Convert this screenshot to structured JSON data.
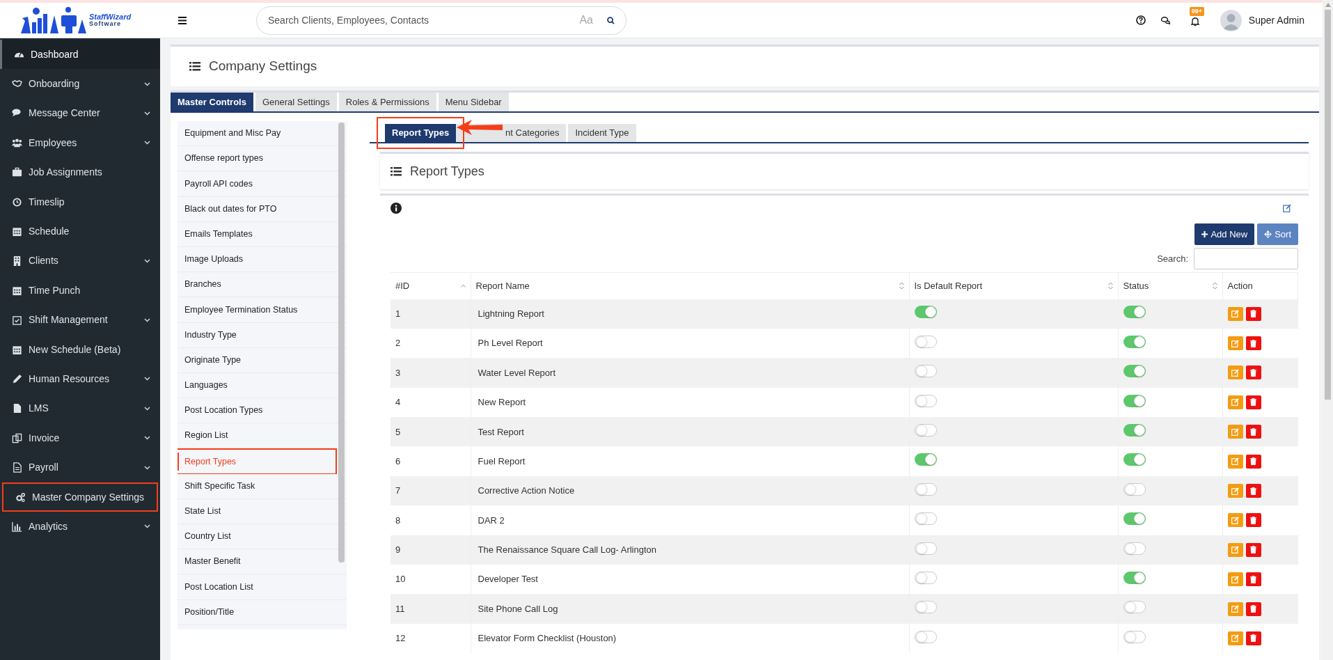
{
  "header": {
    "logo_name": "StaffWizard",
    "logo_tagline": "Software",
    "search_placeholder": "Search Clients, Employees, Contacts",
    "case_toggle": "Aa",
    "notification_count": "99+",
    "user_name": "Super Admin"
  },
  "sidebar": {
    "items": [
      {
        "label": "Dashboard",
        "has_submenu": false,
        "selected": true,
        "annotated": false
      },
      {
        "label": "Onboarding",
        "has_submenu": true,
        "selected": false,
        "annotated": false
      },
      {
        "label": "Message Center",
        "has_submenu": true,
        "selected": false,
        "annotated": false
      },
      {
        "label": "Employees",
        "has_submenu": true,
        "selected": false,
        "annotated": false
      },
      {
        "label": "Job Assignments",
        "has_submenu": false,
        "selected": false,
        "annotated": false
      },
      {
        "label": "Timeslip",
        "has_submenu": false,
        "selected": false,
        "annotated": false
      },
      {
        "label": "Schedule",
        "has_submenu": false,
        "selected": false,
        "annotated": false
      },
      {
        "label": "Clients",
        "has_submenu": true,
        "selected": false,
        "annotated": false
      },
      {
        "label": "Time Punch",
        "has_submenu": false,
        "selected": false,
        "annotated": false
      },
      {
        "label": "Shift Management",
        "has_submenu": true,
        "selected": false,
        "annotated": false
      },
      {
        "label": "New Schedule (Beta)",
        "has_submenu": false,
        "selected": false,
        "annotated": false
      },
      {
        "label": "Human Resources",
        "has_submenu": true,
        "selected": false,
        "annotated": false
      },
      {
        "label": "LMS",
        "has_submenu": true,
        "selected": false,
        "annotated": false
      },
      {
        "label": "Invoice",
        "has_submenu": true,
        "selected": false,
        "annotated": false
      },
      {
        "label": "Payroll",
        "has_submenu": true,
        "selected": false,
        "annotated": false
      },
      {
        "label": "Master Company Settings",
        "has_submenu": false,
        "selected": false,
        "annotated": true
      },
      {
        "label": "Analytics",
        "has_submenu": true,
        "selected": false,
        "annotated": false
      }
    ]
  },
  "page_title": "Company Settings",
  "tabs": [
    {
      "label": "Master Controls",
      "selected": true
    },
    {
      "label": "General Settings",
      "selected": false
    },
    {
      "label": "Roles & Permissions",
      "selected": false
    },
    {
      "label": "Menu Sidebar",
      "selected": false
    }
  ],
  "settings_list": {
    "items": [
      {
        "label": "Equipment and Misc Pay",
        "selected": false,
        "annotated": false
      },
      {
        "label": "Offense report types",
        "selected": false,
        "annotated": false
      },
      {
        "label": "Payroll API codes",
        "selected": false,
        "annotated": false
      },
      {
        "label": "Black out dates for PTO",
        "selected": false,
        "annotated": false
      },
      {
        "label": "Emails Templates",
        "selected": false,
        "annotated": false
      },
      {
        "label": "Image Uploads",
        "selected": false,
        "annotated": false
      },
      {
        "label": "Branches",
        "selected": false,
        "annotated": false
      },
      {
        "label": "Employee Termination Status",
        "selected": false,
        "annotated": false
      },
      {
        "label": "Industry Type",
        "selected": false,
        "annotated": false
      },
      {
        "label": "Originate Type",
        "selected": false,
        "annotated": false
      },
      {
        "label": "Languages",
        "selected": false,
        "annotated": false
      },
      {
        "label": "Post Location Types",
        "selected": false,
        "annotated": false
      },
      {
        "label": "Region List",
        "selected": false,
        "annotated": false
      },
      {
        "label": "Report Types",
        "selected": true,
        "annotated": true
      },
      {
        "label": "Shift Specific Task",
        "selected": false,
        "annotated": false
      },
      {
        "label": "State List",
        "selected": false,
        "annotated": false
      },
      {
        "label": "Country List",
        "selected": false,
        "annotated": false
      },
      {
        "label": "Master Benefit",
        "selected": false,
        "annotated": false
      },
      {
        "label": "Post Location List",
        "selected": false,
        "annotated": false
      },
      {
        "label": "Position/Title",
        "selected": false,
        "annotated": false
      }
    ]
  },
  "sub_tabs": [
    {
      "label": "Report Types",
      "selected": true,
      "annotated": true
    },
    {
      "label": "nt Categories",
      "selected": false,
      "annotated": false
    },
    {
      "label": "Incident Type",
      "selected": false,
      "annotated": false
    }
  ],
  "panel": {
    "title": "Report Types",
    "buttons": [
      {
        "kind": "add",
        "label": "Add New"
      },
      {
        "kind": "sort",
        "label": "Sort"
      }
    ],
    "search_label": "Search:",
    "table": {
      "columns": [
        {
          "label": "#ID",
          "sortable": true,
          "sorted": true
        },
        {
          "label": "Report Name",
          "sortable": true,
          "sorted": false
        },
        {
          "label": "Is Default Report",
          "sortable": true,
          "sorted": false
        },
        {
          "label": "Status",
          "sortable": true,
          "sorted": false
        },
        {
          "label": "Action",
          "sortable": false
        }
      ],
      "rows": [
        {
          "id": "1",
          "name": "Lightning Report",
          "is_default": true,
          "status": true
        },
        {
          "id": "2",
          "name": "Ph Level Report",
          "is_default": false,
          "status": true
        },
        {
          "id": "3",
          "name": "Water Level Report",
          "is_default": false,
          "status": true
        },
        {
          "id": "4",
          "name": "New Report",
          "is_default": false,
          "status": true
        },
        {
          "id": "5",
          "name": "Test Report",
          "is_default": false,
          "status": true
        },
        {
          "id": "6",
          "name": "Fuel Report",
          "is_default": true,
          "status": true
        },
        {
          "id": "7",
          "name": "Corrective Action Notice",
          "is_default": false,
          "status": false
        },
        {
          "id": "8",
          "name": "DAR 2",
          "is_default": false,
          "status": true
        },
        {
          "id": "9",
          "name": "The Renaissance Square Call Log- Arlington",
          "is_default": false,
          "status": false
        },
        {
          "id": "10",
          "name": "Developer Test",
          "is_default": false,
          "status": true
        },
        {
          "id": "11",
          "name": "Site Phone Call Log",
          "is_default": false,
          "status": false
        },
        {
          "id": "12",
          "name": "Elevator Form Checklist (Houston)",
          "is_default": false,
          "status": false
        }
      ]
    }
  }
}
